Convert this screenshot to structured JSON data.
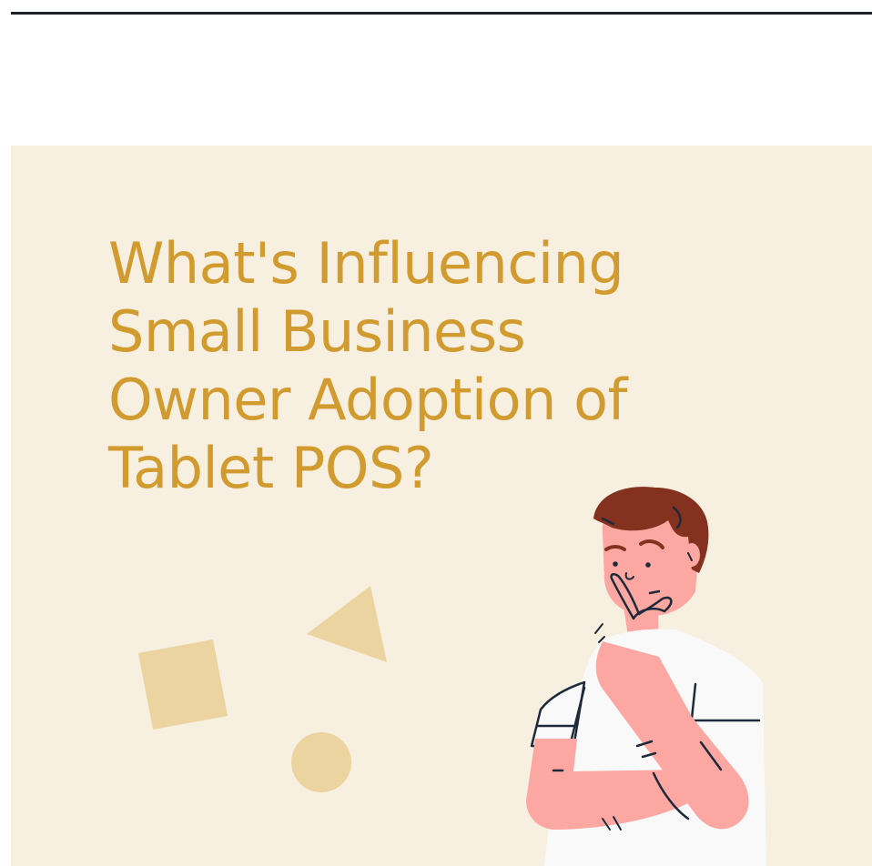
{
  "hero": {
    "title_lines": [
      "What's Influencing",
      "Small Business",
      "Owner Adoption of",
      "Tablet POS?"
    ]
  },
  "colors": {
    "background": "#f7efdf",
    "title": "#d29b2f",
    "shape": "#ecd4a1",
    "skin": "#fca7a1",
    "hair": "#84321f",
    "shirt": "#f9f9f9",
    "outline": "#1e2a3a"
  },
  "illustration": {
    "subject": "thinking-man",
    "shapes": [
      "square-shape",
      "triangle-shape",
      "circle-shape"
    ]
  }
}
